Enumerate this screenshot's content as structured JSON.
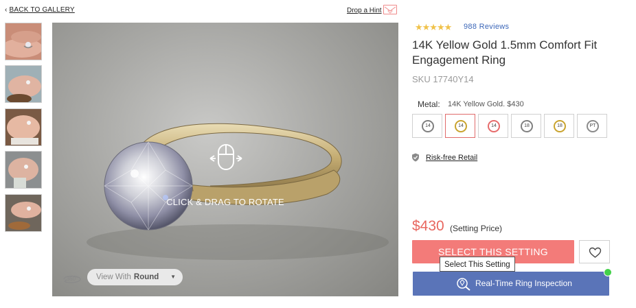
{
  "nav": {
    "back_label": "BACK TO GALLERY",
    "hint_label": "Drop a Hint"
  },
  "thumbnails": [
    {
      "label": "ring-on-hand-1"
    },
    {
      "label": "ring-on-hand-2"
    },
    {
      "label": "ring-on-hand-3"
    },
    {
      "label": "ring-on-hand-4"
    },
    {
      "label": "ring-on-hand-5"
    }
  ],
  "viewer": {
    "instruction": "CLICK & DRAG TO ROTATE",
    "badge_360": "360°",
    "view_with_label": "View With",
    "view_with_value": "Round"
  },
  "product": {
    "rating": 5,
    "stars": "★★★★★",
    "reviews": "988 Reviews",
    "title": "14K Yellow Gold 1.5mm Comfort Fit Engagement Ring",
    "sku": "SKU 17740Y14",
    "metal_label": "Metal:",
    "metal_value": "14K Yellow Gold. $430",
    "metal_options": [
      {
        "code": "14",
        "color": "#7f7f7f",
        "selected": false
      },
      {
        "code": "14",
        "color": "#c9a32d",
        "selected": true
      },
      {
        "code": "14",
        "color": "#e66b6b",
        "selected": false
      },
      {
        "code": "18",
        "color": "#7f7f7f",
        "selected": false
      },
      {
        "code": "18",
        "color": "#c9a32d",
        "selected": false
      },
      {
        "code": "PT",
        "color": "#8a8a8a",
        "selected": false
      }
    ],
    "risk_free": "Risk-free Retail",
    "price": "$430",
    "price_note": "(Setting Price)"
  },
  "actions": {
    "select_label": "SELECT THIS SETTING",
    "tooltip": "Select This Setting",
    "inspection_label": "Real-Time Ring Inspection"
  },
  "colors": {
    "accent": "#f37b79",
    "price": "#e8675f",
    "inspection": "#5a74b8",
    "stars": "#f0c24a",
    "online": "#43d14a"
  }
}
